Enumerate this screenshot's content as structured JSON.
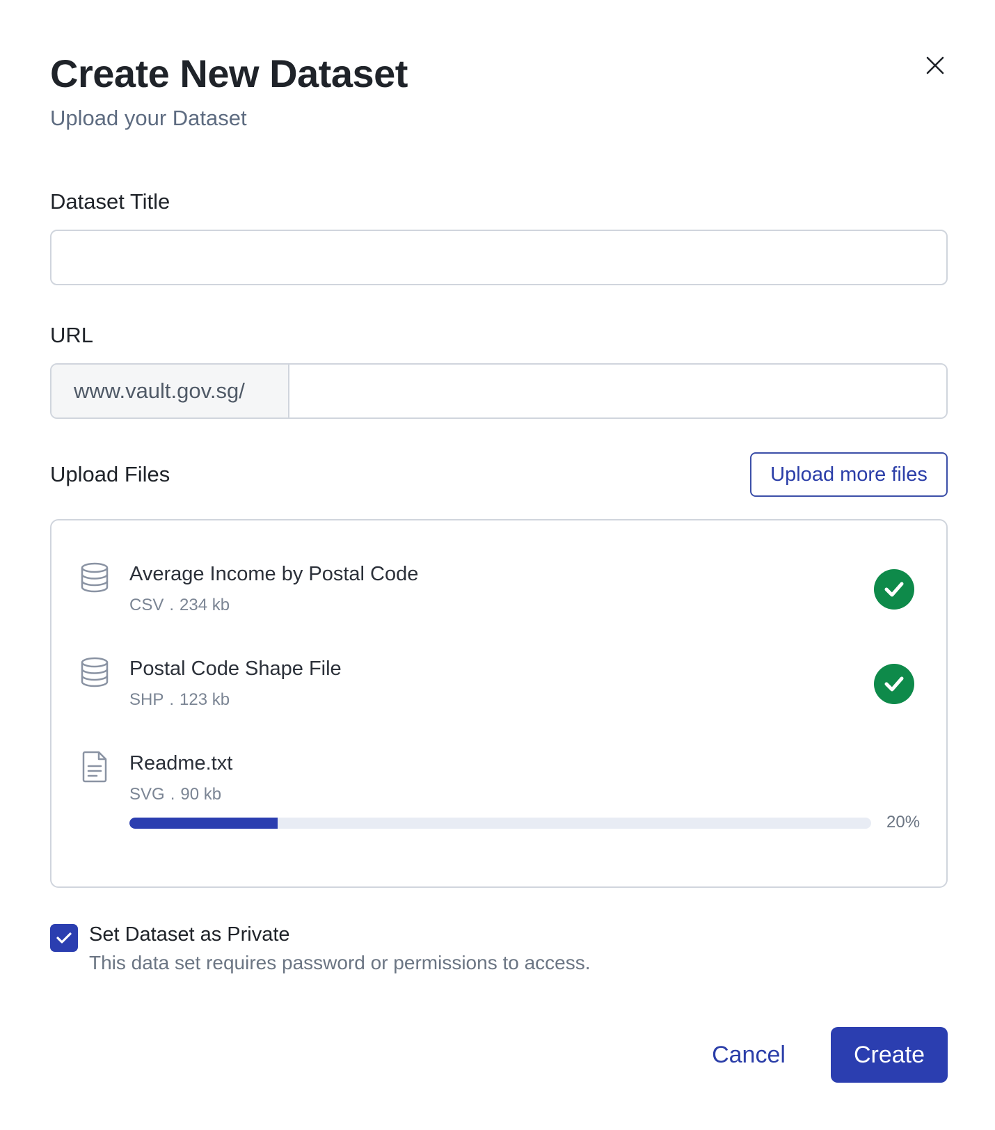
{
  "dialog": {
    "title": "Create New Dataset",
    "subtitle": "Upload your Dataset",
    "close_icon": "close-icon"
  },
  "form": {
    "dataset_title_label": "Dataset Title",
    "dataset_title_value": "",
    "url_label": "URL",
    "url_prefix": "www.vault.gov.sg/",
    "url_value": "",
    "upload_label": "Upload Files",
    "upload_more_label": "Upload more files"
  },
  "files": [
    {
      "name": "Average Income by Postal Code",
      "type": "CSV",
      "separator": ".",
      "size": "234 kb",
      "icon": "database-icon",
      "status": "complete",
      "status_icon": "check-circle-icon"
    },
    {
      "name": "Postal Code Shape File",
      "type": "SHP",
      "separator": ".",
      "size": "123 kb",
      "icon": "database-icon",
      "status": "complete",
      "status_icon": "check-circle-icon"
    },
    {
      "name": "Readme.txt",
      "type": "SVG",
      "separator": ".",
      "size": "90 kb",
      "icon": "document-icon",
      "status": "uploading",
      "progress": 0.2,
      "progress_label": "20%"
    }
  ],
  "privacy": {
    "checked": true,
    "label": "Set Dataset as Private",
    "description": "This data set requires password or permissions to access."
  },
  "actions": {
    "cancel_label": "Cancel",
    "create_label": "Create"
  },
  "colors": {
    "primary": "#2b3eb0",
    "success": "#0e8a4a",
    "progress_track": "#e8ecf4"
  }
}
